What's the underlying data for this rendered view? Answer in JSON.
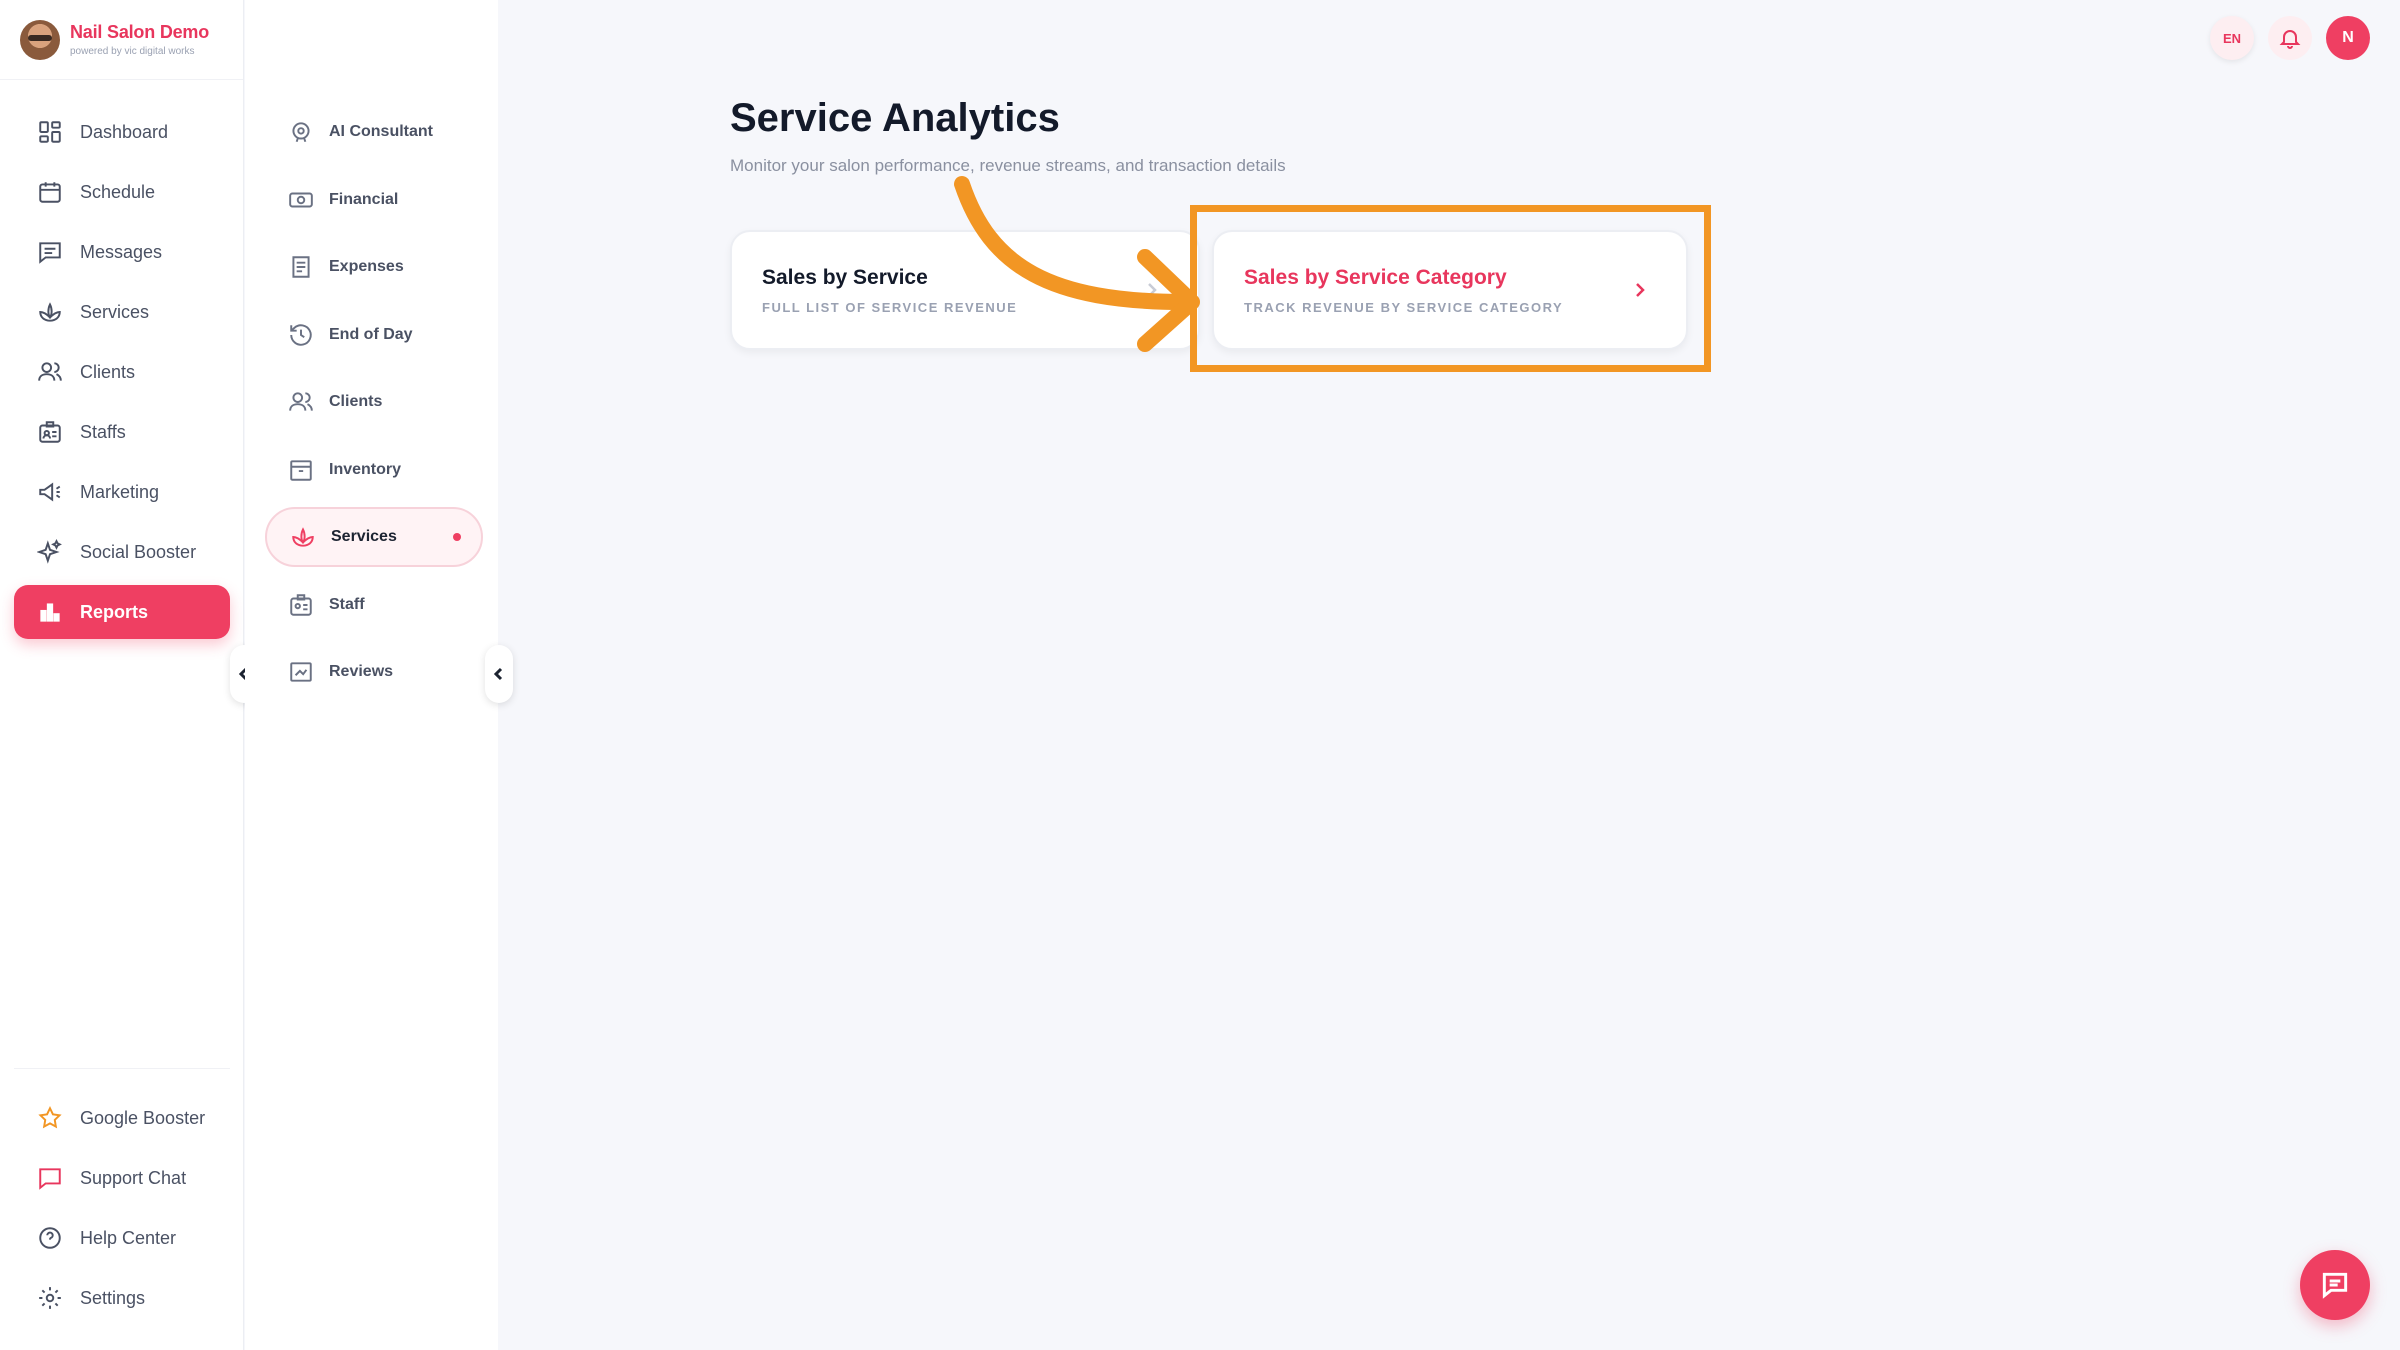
{
  "brand": {
    "name": "Nail Salon Demo",
    "tagline": "powered by vic digital works"
  },
  "sidebar": {
    "items": [
      {
        "label": "Dashboard",
        "icon": "dashboard-icon"
      },
      {
        "label": "Schedule",
        "icon": "calendar-icon"
      },
      {
        "label": "Messages",
        "icon": "message-icon"
      },
      {
        "label": "Services",
        "icon": "lotus-icon"
      },
      {
        "label": "Clients",
        "icon": "users-icon"
      },
      {
        "label": "Staffs",
        "icon": "id-badge-icon"
      },
      {
        "label": "Marketing",
        "icon": "megaphone-icon"
      },
      {
        "label": "Social Booster",
        "icon": "sparkles-icon"
      },
      {
        "label": "Reports",
        "icon": "bar-chart-icon",
        "active": true
      }
    ],
    "bottom_items": [
      {
        "label": "Google Booster",
        "icon": "star-icon"
      },
      {
        "label": "Support Chat",
        "icon": "chat-icon"
      },
      {
        "label": "Help Center",
        "icon": "help-icon"
      },
      {
        "label": "Settings",
        "icon": "gear-icon"
      }
    ]
  },
  "subnav": {
    "items": [
      {
        "label": "AI Consultant",
        "icon": "ai-icon"
      },
      {
        "label": "Financial",
        "icon": "money-icon"
      },
      {
        "label": "Expenses",
        "icon": "receipt-icon"
      },
      {
        "label": "End of Day",
        "icon": "history-icon"
      },
      {
        "label": "Clients",
        "icon": "users-icon"
      },
      {
        "label": "Inventory",
        "icon": "archive-icon"
      },
      {
        "label": "Services",
        "icon": "lotus-icon",
        "active": true
      },
      {
        "label": "Staff",
        "icon": "id-badge-icon"
      },
      {
        "label": "Reviews",
        "icon": "review-icon"
      }
    ]
  },
  "header": {
    "language": "EN",
    "user_initial": "N"
  },
  "main": {
    "title": "Service Analytics",
    "subtitle": "Monitor your salon performance, revenue streams, and transaction details",
    "cards": [
      {
        "title": "Sales by Service",
        "subtitle": "FULL LIST OF SERVICE REVENUE"
      },
      {
        "title": "Sales by Service Category",
        "subtitle": "TRACK REVENUE BY SERVICE CATEGORY"
      }
    ]
  },
  "colors": {
    "accent": "#ef3f62",
    "highlight": "#f29624",
    "background": "#f6f7fb"
  }
}
